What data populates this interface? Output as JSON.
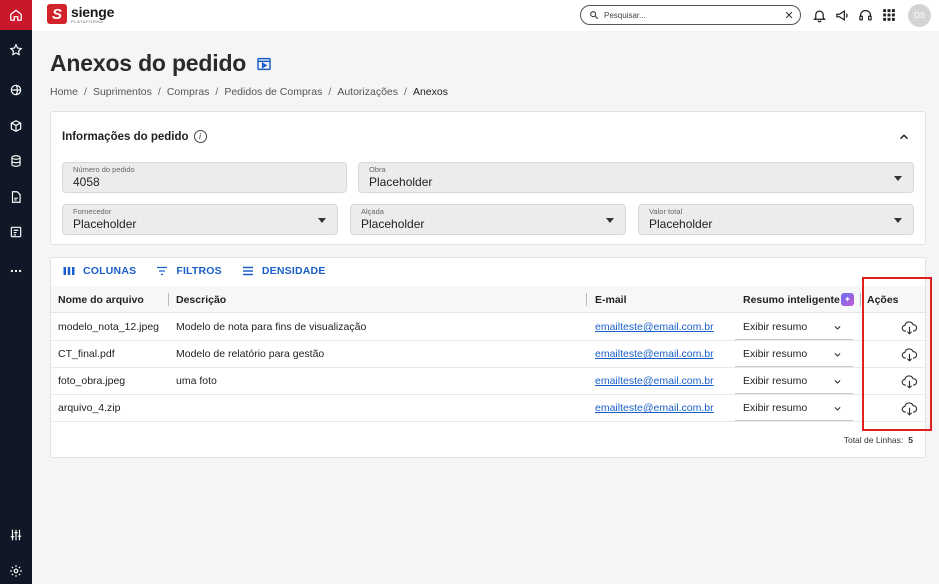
{
  "app": {
    "logo_mark": "S",
    "logo_name": "sienge",
    "logo_sub": "PLATAFORMA"
  },
  "topbar": {
    "search_placeholder": "Pesquisar...",
    "avatar_initials": "DS"
  },
  "sidebar": {
    "items": [
      "home-icon",
      "star-icon",
      "globe-icon",
      "box-icon",
      "coins-icon",
      "document-icon",
      "invoice-icon",
      "more-icon",
      "sliders-icon",
      "settings-icon"
    ]
  },
  "page": {
    "title": "Anexos do pedido",
    "breadcrumb": [
      "Home",
      "Suprimentos",
      "Compras",
      "Pedidos de Compras",
      "Autorizações",
      "Anexos"
    ]
  },
  "info_card": {
    "title": "Informações do pedido",
    "fields": {
      "numero": {
        "label": "Número do pedido",
        "value": "4058"
      },
      "obra": {
        "label": "Obra",
        "value": "Placeholder"
      },
      "fornecedor": {
        "label": "Fornecedor",
        "value": "Placeholder"
      },
      "alcada": {
        "label": "Alçada",
        "value": "Placeholder"
      },
      "valor_total": {
        "label": "Valor total",
        "value": "Placeholder"
      }
    }
  },
  "table": {
    "toolbar": {
      "colunas": "COLUNAS",
      "filtros": "FILTROS",
      "densidade": "DENSIDADE"
    },
    "headers": {
      "arquivo": "Nome do arquivo",
      "descricao": "Descrição",
      "email": "E-mail",
      "resumo": "Resumo inteligente",
      "acoes": "Ações"
    },
    "rows": [
      {
        "arquivo": "modelo_nota_12.jpeg",
        "descricao": "Modelo de nota para fins de visualização",
        "email": "emailteste@email.com.br",
        "resumo": "Exibir resumo"
      },
      {
        "arquivo": "CT_final.pdf",
        "descricao": "Modelo de relatório para gestão",
        "email": "emailteste@email.com.br",
        "resumo": "Exibir resumo"
      },
      {
        "arquivo": "foto_obra.jpeg",
        "descricao": "uma foto",
        "email": "emailteste@email.com.br",
        "resumo": "Exibir resumo"
      },
      {
        "arquivo": "arquivo_4.zip",
        "descricao": "",
        "email": "emailteste@email.com.br",
        "resumo": "Exibir resumo"
      }
    ],
    "total_label": "Total de Linhas:",
    "total_value": "5"
  },
  "colors": {
    "brand": "#d2232a",
    "sidebar_bg": "#101827",
    "link": "#1a5fc9",
    "highlight": "#e01e1e"
  }
}
